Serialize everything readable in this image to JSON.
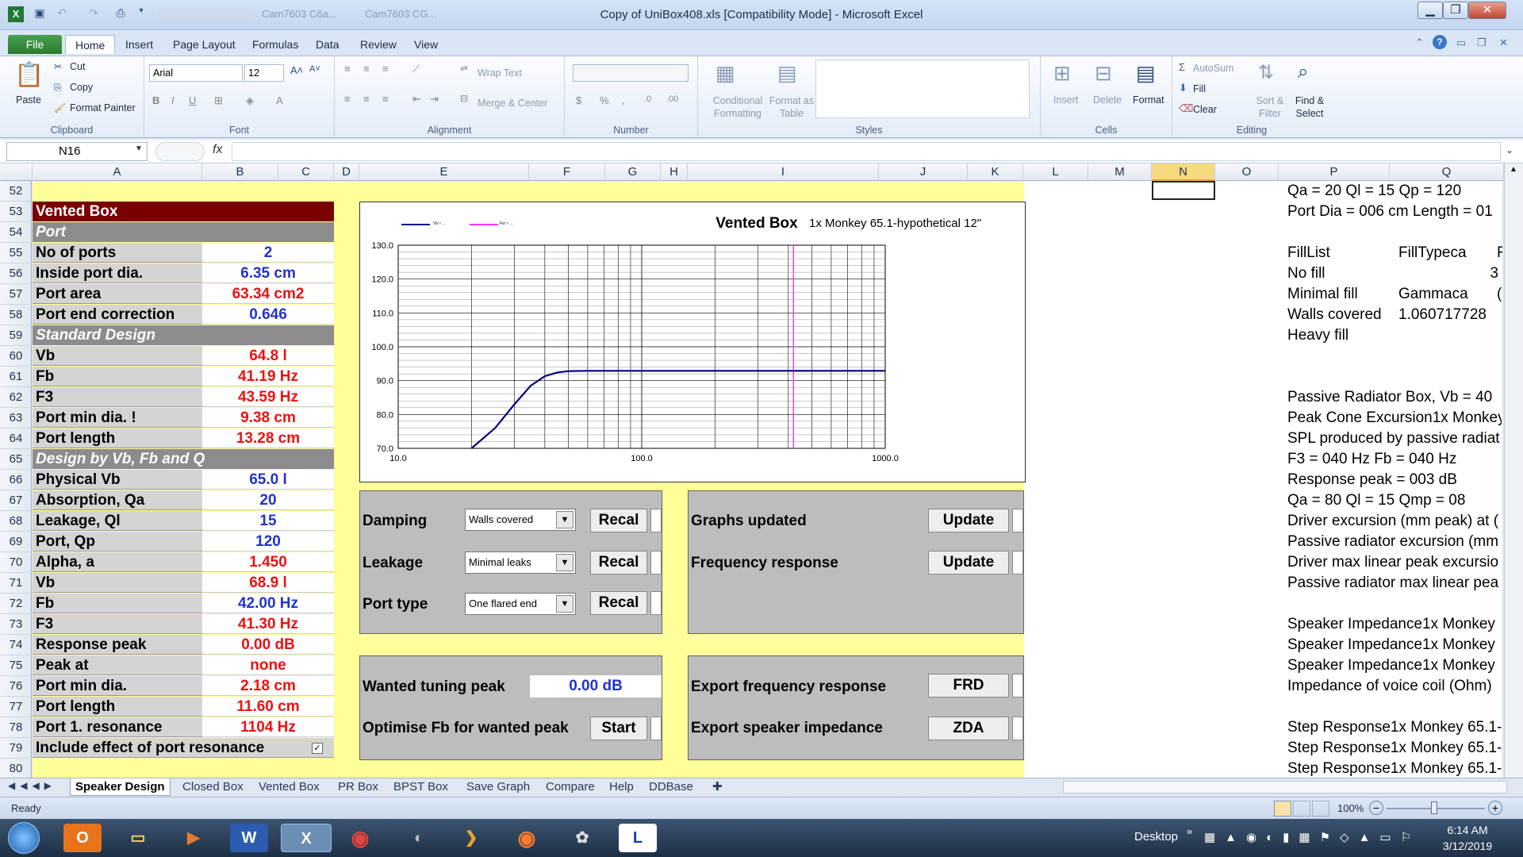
{
  "window": {
    "title": "Copy of UniBox408.xls  [Compatibility Mode]  -  Microsoft Excel",
    "blurred_tab1": "Cam7603 C6a...",
    "blurred_tab2": "Cam7603 CG..."
  },
  "ribbon_tabs": [
    "File",
    "Home",
    "Insert",
    "Page Layout",
    "Formulas",
    "Data",
    "Review",
    "View"
  ],
  "clipboard": {
    "paste": "Paste",
    "cut": "Cut",
    "copy": "Copy",
    "format_painter": "Format Painter",
    "group": "Clipboard"
  },
  "font": {
    "name": "Arial",
    "size": "12",
    "group": "Font"
  },
  "alignment": {
    "wrap": "Wrap Text",
    "merge": "Merge & Center",
    "group": "Alignment"
  },
  "number": {
    "group": "Number"
  },
  "styles": {
    "cond": "Conditional Formatting",
    "fmt_table": "Format as Table",
    "group": "Styles"
  },
  "cells": {
    "insert": "Insert",
    "delete": "Delete",
    "format": "Format",
    "group": "Cells"
  },
  "editing": {
    "autosum": "AutoSum",
    "fill": "Fill",
    "clear": "Clear",
    "sort": "Sort & Filter",
    "find": "Find & Select",
    "group": "Editing"
  },
  "namebox": "N16",
  "fx": "fx",
  "columns": [
    {
      "l": "A"
    },
    {
      "l": "B"
    },
    {
      "l": "C"
    },
    {
      "l": "D"
    },
    {
      "l": "E"
    },
    {
      "l": "F"
    },
    {
      "l": "G"
    },
    {
      "l": "H"
    },
    {
      "l": "I"
    },
    {
      "l": "J"
    },
    {
      "l": "K"
    },
    {
      "l": "L"
    },
    {
      "l": "M"
    },
    {
      "l": "N"
    },
    {
      "l": "O"
    },
    {
      "l": "P"
    },
    {
      "l": "Q"
    }
  ],
  "rows": [
    "52",
    "53",
    "54",
    "55",
    "56",
    "57",
    "58",
    "59",
    "60",
    "61",
    "62",
    "63",
    "64",
    "65",
    "66",
    "67",
    "68",
    "69",
    "70",
    "71",
    "72",
    "73",
    "74",
    "75",
    "76",
    "77",
    "78",
    "79",
    "80"
  ],
  "left_table": [
    {
      "label": "Vented Box",
      "value": "",
      "style": "dark"
    },
    {
      "label": "Port",
      "value": "",
      "style": "grey"
    },
    {
      "label": "No of ports",
      "value": "2",
      "color": "blue"
    },
    {
      "label": "Inside port dia.",
      "value": "6.35 cm",
      "color": "blue"
    },
    {
      "label": "Port area",
      "value": "63.34 cm2",
      "color": "red"
    },
    {
      "label": "Port end correction",
      "value": "0.646",
      "color": "blue"
    },
    {
      "label": "Standard Design",
      "value": "",
      "style": "grey"
    },
    {
      "label": "Vb",
      "value": "64.8 l",
      "color": "red"
    },
    {
      "label": "Fb",
      "value": "41.19 Hz",
      "color": "red"
    },
    {
      "label": "F3",
      "value": "43.59 Hz",
      "color": "red"
    },
    {
      "label": "Port min dia. !",
      "value": "9.38 cm",
      "color": "red"
    },
    {
      "label": "Port length",
      "value": "13.28 cm",
      "color": "red"
    },
    {
      "label": "Design by Vb, Fb and Q",
      "value": "",
      "style": "grey"
    },
    {
      "label": "Physical Vb",
      "value": "65.0 l",
      "color": "blue"
    },
    {
      "label": "Absorption, Qa",
      "value": "20",
      "color": "blue"
    },
    {
      "label": "Leakage, Ql",
      "value": "15",
      "color": "blue"
    },
    {
      "label": "Port, Qp",
      "value": "120",
      "color": "blue"
    },
    {
      "label": "Alpha, a",
      "value": "1.450",
      "color": "red"
    },
    {
      "label": "Vb",
      "value": "68.9 l",
      "color": "red"
    },
    {
      "label": "Fb",
      "value": "42.00 Hz",
      "color": "blue"
    },
    {
      "label": "F3",
      "value": "41.30 Hz",
      "color": "red"
    },
    {
      "label": "Response peak",
      "value": "0.00 dB",
      "color": "red"
    },
    {
      "label": "Peak at",
      "value": "none",
      "color": "red"
    },
    {
      "label": "Port min dia.",
      "value": "2.18 cm",
      "color": "red"
    },
    {
      "label": "Port length",
      "value": "11.60 cm",
      "color": "red"
    },
    {
      "label": "Port 1. resonance",
      "value": "1104 Hz",
      "color": "red"
    },
    {
      "label": "Include effect of port resonance",
      "value": "",
      "style": "check"
    }
  ],
  "chart": {
    "title": "Vented Box",
    "subtitle": "1x Monkey 65.1-hypothetical 12\"",
    "legend1": "Vb ≈ ...",
    "legend2": "Fsr ≈ ..."
  },
  "chart_data": {
    "type": "line",
    "x_scale": "log",
    "xlim": [
      10,
      1000
    ],
    "ylim": [
      70,
      130
    ],
    "x_ticks": [
      "10.0",
      "100.0",
      "1000.0"
    ],
    "y_ticks": [
      "130.0",
      "120.0",
      "110.0",
      "100.0",
      "90.0",
      "80.0",
      "70.0"
    ],
    "series": [
      {
        "color": "#000080",
        "x": [
          20,
          25,
          30,
          35,
          40,
          45,
          50,
          60,
          80,
          100,
          200,
          500,
          1000
        ],
        "y": [
          70,
          76,
          83,
          88.5,
          91.3,
          92.4,
          92.8,
          92.9,
          92.9,
          92.9,
          92.9,
          92.9,
          92.9
        ]
      }
    ],
    "vline_x": 420,
    "vline_color": "#ff33ff",
    "grid": true
  },
  "controls": {
    "damping": "Damping",
    "damping_val": "Walls covered",
    "leakage": "Leakage",
    "leakage_val": "Minimal leaks",
    "porttype": "Port type",
    "porttype_val": "One flared end",
    "recal": "Recal",
    "wanted": "Wanted tuning peak",
    "wanted_val": "0.00 dB",
    "optimise": "Optimise Fb for wanted peak",
    "start": "Start",
    "graphs": "Graphs updated",
    "freq": "Frequency response",
    "update": "Update",
    "export_fr": "Export frequency response",
    "frd": "FRD",
    "export_si": "Export speaker impedance",
    "zda": "ZDA"
  },
  "right_col": [
    {
      "row": 0,
      "p": "Qa = 20  Ql = 15  Qp = 120",
      "q": ""
    },
    {
      "row": 1,
      "p": "Port Dia = 006 cm  Length = 01",
      "q": ""
    },
    {
      "row": 3,
      "p": "FillList",
      "q": "FillTypeca",
      "r": "F"
    },
    {
      "row": 4,
      "p": "No fill",
      "q": "3",
      "qright": true
    },
    {
      "row": 5,
      "p": "Minimal fill",
      "q": "Gammaca",
      "r": "("
    },
    {
      "row": 6,
      "p": "Walls covered",
      "q": "1.060717728"
    },
    {
      "row": 7,
      "p": "Heavy fill",
      "q": ""
    },
    {
      "row": 10,
      "p": "Passive Radiator Box, Vb = 40",
      "q": ""
    },
    {
      "row": 11,
      "p": "Peak Cone Excursion1x Monkey",
      "q": ""
    },
    {
      "row": 12,
      "p": "SPL produced by passive radiat",
      "q": ""
    },
    {
      "row": 13,
      "p": "F3 = 040 Hz  Fb = 040 Hz",
      "q": ""
    },
    {
      "row": 14,
      "p": "Response peak = 003 dB",
      "q": ""
    },
    {
      "row": 15,
      "p": "Qa = 80  Ql = 15  Qmp = 08",
      "q": ""
    },
    {
      "row": 16,
      "p": "Driver excursion (mm peak) at (",
      "q": ""
    },
    {
      "row": 17,
      "p": "Passive radiator excursion (mm",
      "q": ""
    },
    {
      "row": 18,
      "p": "Driver max linear peak excursio",
      "q": ""
    },
    {
      "row": 19,
      "p": "Passive radiator max linear pea",
      "q": ""
    },
    {
      "row": 21,
      "p": "Speaker Impedance1x Monkey",
      "q": ""
    },
    {
      "row": 22,
      "p": "Speaker Impedance1x Monkey",
      "q": ""
    },
    {
      "row": 23,
      "p": "Speaker Impedance1x Monkey",
      "q": ""
    },
    {
      "row": 24,
      "p": "Impedance of voice coil (Ohm)",
      "q": ""
    },
    {
      "row": 26,
      "p": "Step Response1x Monkey 65.1-",
      "q": ""
    },
    {
      "row": 27,
      "p": "Step Response1x Monkey 65.1-",
      "q": ""
    },
    {
      "row": 28,
      "p": "Step Response1x Monkey 65.1-",
      "q": ""
    }
  ],
  "sheet_tabs": [
    "Speaker Design",
    "Closed Box",
    "Vented Box",
    "PR Box",
    "BPST Box",
    "Save Graph",
    "Compare",
    "Help",
    "DDBase"
  ],
  "status": {
    "ready": "Ready",
    "zoom": "100%"
  },
  "taskbar": {
    "desktop": "Desktop",
    "time": "6:14 AM",
    "date": "3/12/2019"
  }
}
